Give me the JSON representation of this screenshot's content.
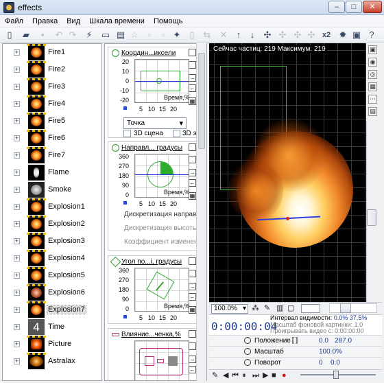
{
  "window": {
    "title": "effects",
    "min": "–",
    "max": "□",
    "close": "✕"
  },
  "menu": [
    "Файл",
    "Правка",
    "Вид",
    "Шкала времени",
    "Помощь"
  ],
  "tree": {
    "items": [
      {
        "label": "Fire1",
        "thumb": "fire"
      },
      {
        "label": "Fire2",
        "thumb": "fire"
      },
      {
        "label": "Fire3",
        "thumb": "fire"
      },
      {
        "label": "Fire4",
        "thumb": "fire"
      },
      {
        "label": "Fire5",
        "thumb": "fire"
      },
      {
        "label": "Fire6",
        "thumb": "fire"
      },
      {
        "label": "Fire7",
        "thumb": "fire"
      },
      {
        "label": "Flame",
        "thumb": "flame"
      },
      {
        "label": "Smoke",
        "thumb": "smoke"
      },
      {
        "label": "Explosion1",
        "thumb": "fire"
      },
      {
        "label": "Explosion2",
        "thumb": "fire"
      },
      {
        "label": "Explosion3",
        "thumb": "fire"
      },
      {
        "label": "Explosion4",
        "thumb": "fire"
      },
      {
        "label": "Explosion5",
        "thumb": "fire"
      },
      {
        "label": "Explosion6",
        "thumb": "exp6"
      },
      {
        "label": "Explosion7",
        "thumb": "fire"
      },
      {
        "label": "Time",
        "thumb": "time"
      },
      {
        "label": "Picture",
        "thumb": "pic"
      },
      {
        "label": "Astralax",
        "thumb": "astra"
      }
    ],
    "selected": "Explosion7"
  },
  "mid": {
    "card1": {
      "title": "Координ...иксели",
      "y_ticks": [
        "20",
        "10",
        "0",
        "-10",
        "-20"
      ],
      "x_ticks": [
        "5",
        "10",
        "15",
        "20"
      ],
      "axis_label": "Время,%",
      "select": "Точка",
      "cb1": "3D сцена",
      "cb2": "3D эми"
    },
    "card2": {
      "title": "Направл... градусы",
      "y_ticks": [
        "360",
        "270",
        "180",
        "90",
        "0"
      ],
      "x_ticks": [
        "5",
        "10",
        "15",
        "20"
      ],
      "axis_label": "Время,%",
      "t1": "Дискретизация направле",
      "t2": "Дискретизация высоты э",
      "t3": "Коэффициент изменения"
    },
    "card3": {
      "title": "Угол по...і, градусы",
      "y_ticks": [
        "360",
        "270",
        "180",
        "90",
        "0"
      ],
      "x_ticks": [
        "5",
        "10",
        "15",
        "20"
      ],
      "axis_label": "Время,%"
    },
    "card4": {
      "title": "Влияние...ченка,%"
    }
  },
  "viewport": {
    "hud": "Сейчас частиц: 219    Максимум: 219",
    "zoom": "100.0%"
  },
  "timeinfo": {
    "time": "0:00:00:04",
    "interval_label": "Интервал видимости:",
    "interval_a": "0.0%",
    "interval_b": "37.5%",
    "bg_scale": "Масштаб фоновой картинки: 1.0",
    "video": "Проигрывать видео с: 0:00:00:00"
  },
  "props": [
    {
      "label": "Положение",
      "v1": "0.0",
      "v2": "287.0"
    },
    {
      "label": "Масштаб",
      "v1": "100.0%",
      "v2": ""
    },
    {
      "label": "Поворот",
      "v1": "0",
      "v2": "0.0"
    }
  ]
}
